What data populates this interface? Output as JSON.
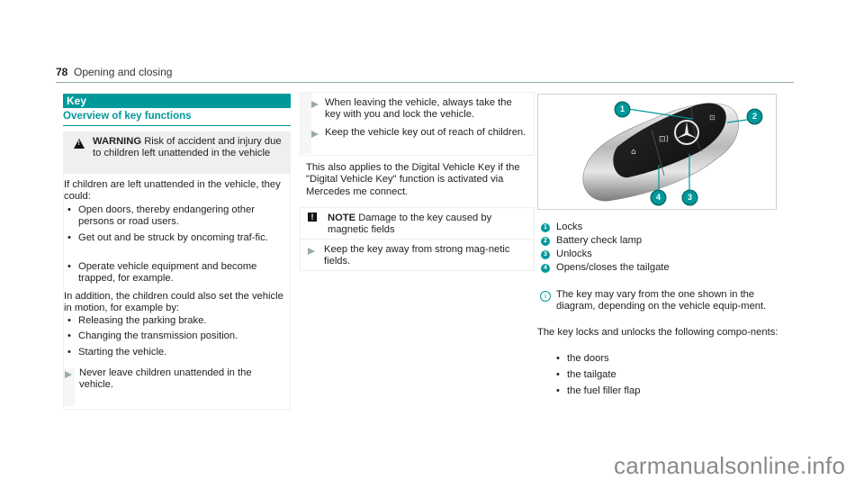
{
  "header": {
    "page_number": "78",
    "chapter": "Opening and closing"
  },
  "section": {
    "title": "Key",
    "subtitle": "Overview of key functions"
  },
  "warning": {
    "label": "WARNING",
    "title": "Risk of accident and injury due to children left unattended in the vehicle",
    "intro": "If children are left unattended in the vehicle, they could:",
    "risks": [
      "Open doors, thereby endangering other persons or road users.",
      "Get out and be struck by oncoming traf-fic.",
      "Operate vehicle equipment and become trapped, for example."
    ],
    "intro2": "In addition, the children could also set the vehicle in motion, for example by:",
    "motion_risks": [
      "Releasing the parking brake.",
      "Changing the transmission position.",
      "Starting the vehicle."
    ],
    "actions": [
      "Never leave children unattended in the vehicle.",
      "When leaving the vehicle, always take the key with you and lock the vehicle.",
      "Keep the vehicle key out of reach of children."
    ]
  },
  "digital_key_text": "This also applies to the Digital Vehicle Key if the \"Digital Vehicle Key\" function is activated via Mercedes me connect.",
  "note": {
    "label": "NOTE",
    "title": "Damage to the key caused by magnetic fields",
    "action": "Keep the key away from strong mag-netic fields."
  },
  "figure": {
    "description": "Mercedes-Benz vehicle key with callouts",
    "callouts": [
      "1",
      "2",
      "3",
      "4"
    ]
  },
  "legend": [
    {
      "num": "1",
      "label": "Locks"
    },
    {
      "num": "2",
      "label": "Battery check lamp"
    },
    {
      "num": "3",
      "label": "Unlocks"
    },
    {
      "num": "4",
      "label": "Opens/closes the tailgate"
    }
  ],
  "info_note": "The key may vary from the one shown in the diagram, depending on the vehicle equip-ment.",
  "components_intro": "The key locks and unlocks the following compo-nents:",
  "components": [
    "the doors",
    "the tailgate",
    "the fuel filler flap"
  ],
  "watermark": "carmanualsonline.info",
  "colors": {
    "accent": "#00999a",
    "warning_bg": "#efefef",
    "action_arrow": "#9aaba6"
  }
}
